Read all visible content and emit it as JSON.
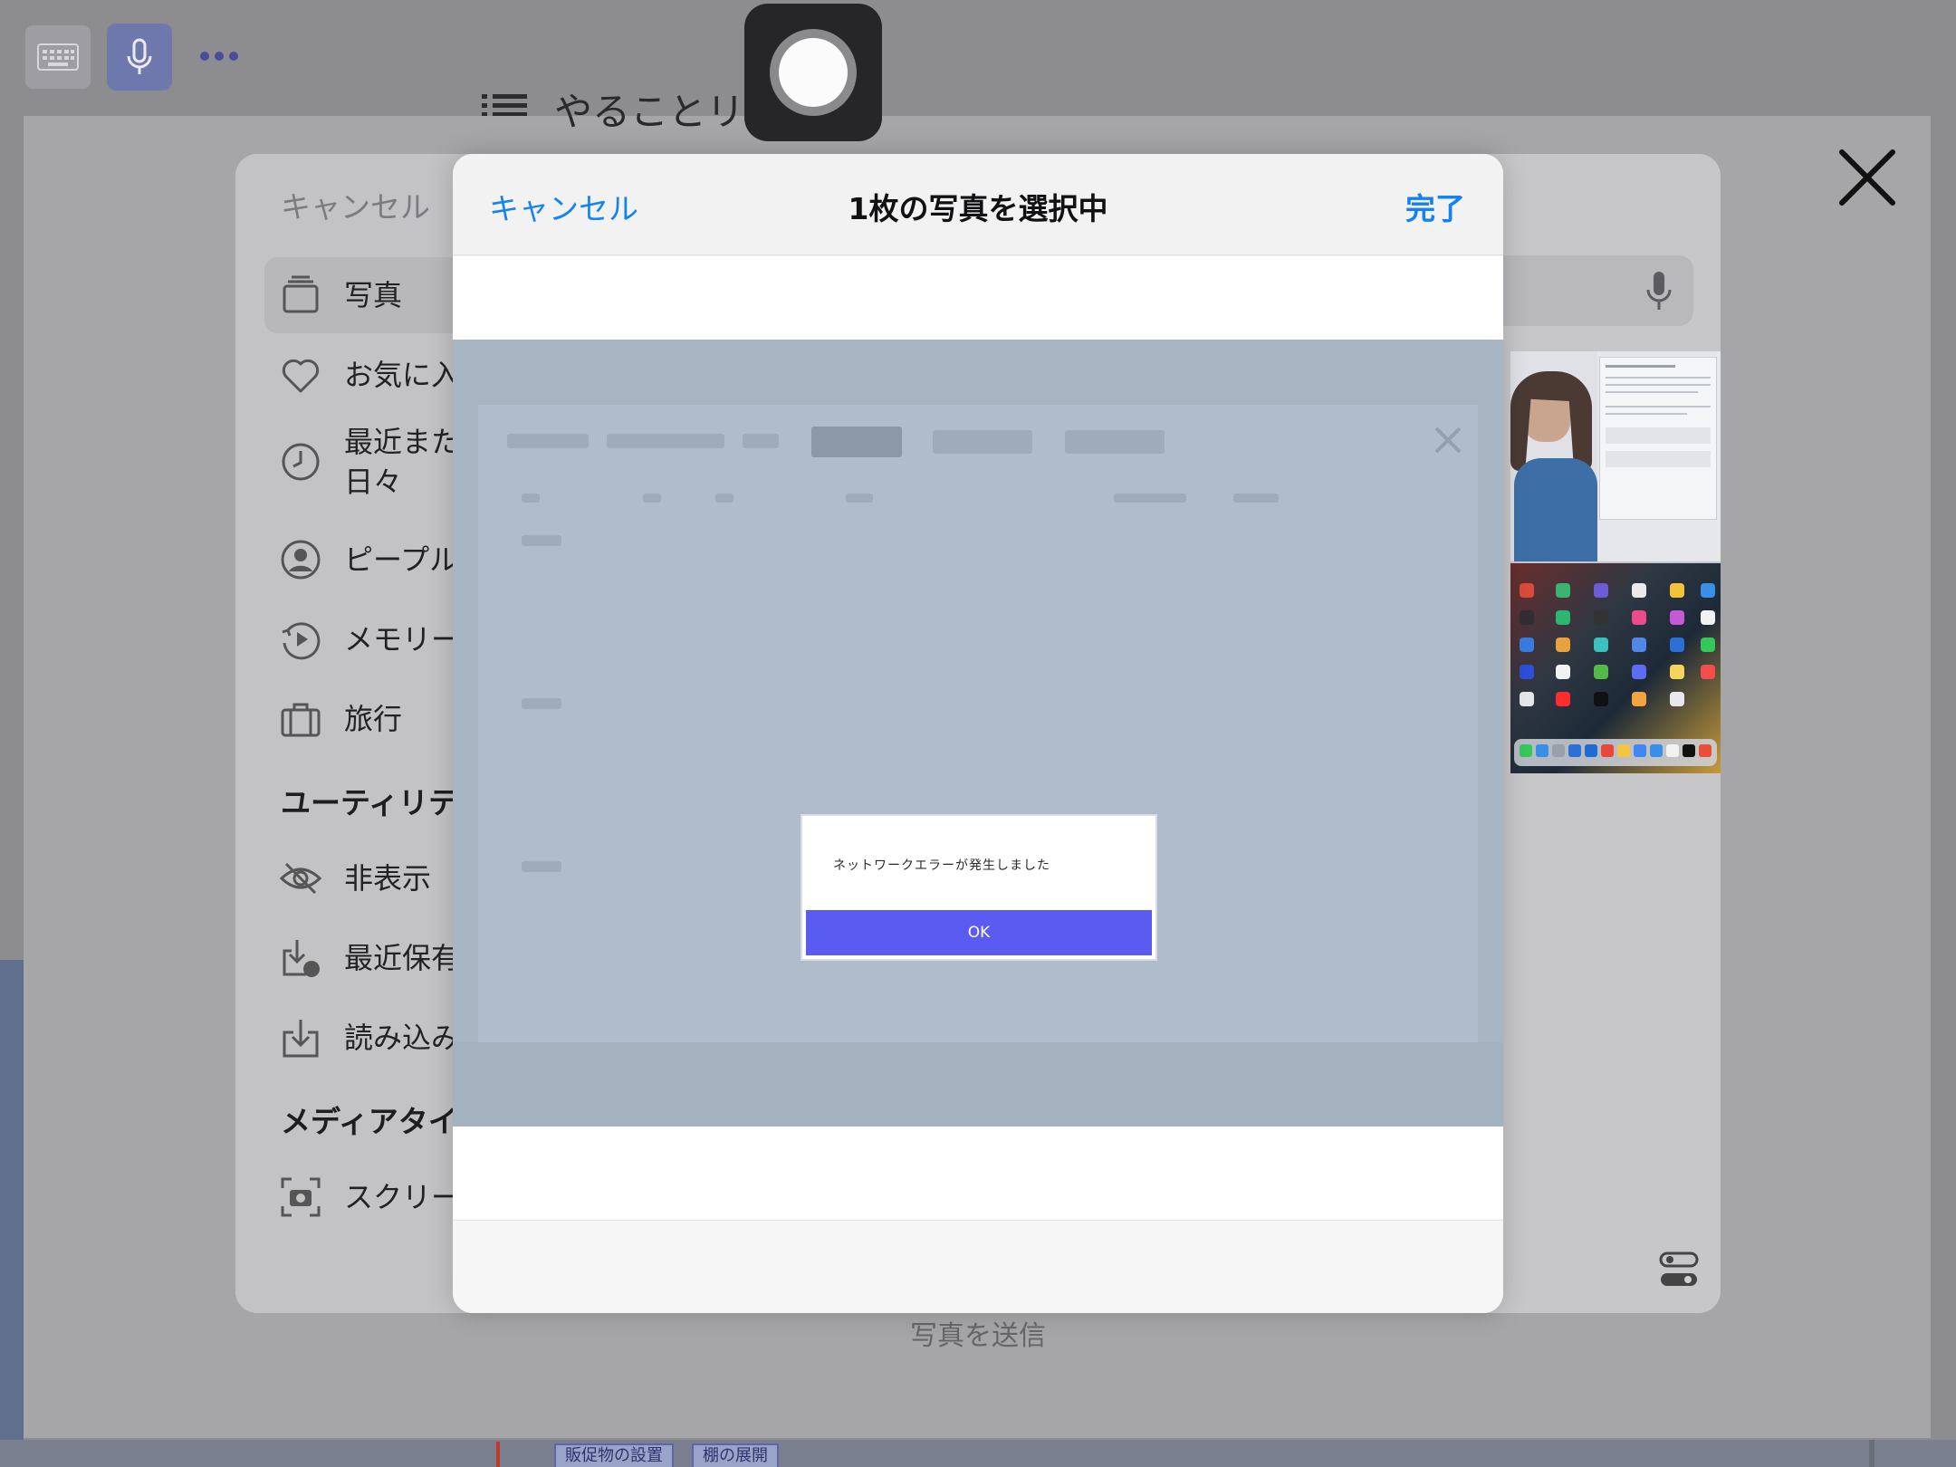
{
  "background_app": {
    "title": "やることリスト",
    "send_photo_label": "写真を送信",
    "bottom_chips": [
      "販促物の設置",
      "棚の展開"
    ]
  },
  "photo_picker": {
    "cancel_label": "キャンセル",
    "sidebar": {
      "items": [
        {
          "label": "写真",
          "icon": "photos-stack-icon"
        },
        {
          "label": "お気に入",
          "icon": "heart-icon"
        },
        {
          "label": "最近また",
          "label2": "日々",
          "icon": "clock-icon"
        },
        {
          "label": "ピープル",
          "icon": "person-icon"
        },
        {
          "label": "メモリー",
          "icon": "memories-play-icon"
        },
        {
          "label": "旅行",
          "icon": "suitcase-icon"
        }
      ],
      "section_utilities": "ユーティリテ",
      "utility_items": [
        {
          "label": "非表示",
          "icon": "eye-slash-icon"
        },
        {
          "label": "最近保有",
          "icon": "recently-saved-icon"
        },
        {
          "label": "読み込み",
          "icon": "import-icon"
        }
      ],
      "section_media": "メディアタイ",
      "media_items": [
        {
          "label": "スクリー",
          "icon": "screenshot-icon"
        }
      ]
    }
  },
  "dialog": {
    "cancel_label": "キャンセル",
    "title": "1枚の写真を選択中",
    "done_label": "完了"
  },
  "alert": {
    "message": "ネットワークエラーが発生しました",
    "ok_label": "OK"
  },
  "colors": {
    "ios_blue": "#1482f0",
    "alert_button": "#5a5bf0",
    "record_button": "#262628"
  }
}
